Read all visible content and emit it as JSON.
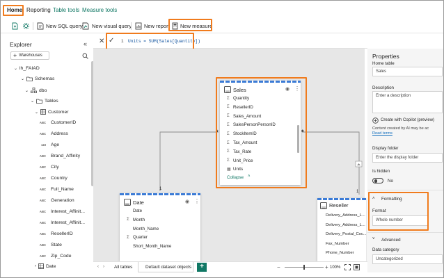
{
  "ribbon": {
    "tabs": [
      {
        "label": "Home"
      },
      {
        "label": "Reporting"
      },
      {
        "label": "Table tools"
      },
      {
        "label": "Measure tools"
      }
    ]
  },
  "toolbar": {
    "new_sql_query": "New SQL query",
    "new_visual_query": "New visual query",
    "new_report": "New report",
    "new_measure": "New measure"
  },
  "formula_bar": {
    "line_number": "1",
    "formula": "Units = SUM(Sales[Quantity])"
  },
  "explorer": {
    "title": "Explorer",
    "warehouses_button": "Warehouses",
    "tree": [
      {
        "label": "lh_FAIAD"
      },
      {
        "label": "Schemas"
      },
      {
        "label": "dbo"
      },
      {
        "label": "Tables"
      },
      {
        "label": "Customer"
      }
    ],
    "customer_columns": [
      {
        "type": "ABC",
        "name": "CustomerID"
      },
      {
        "type": "ABC",
        "name": "Address"
      },
      {
        "type": "123",
        "name": "Age"
      },
      {
        "type": "ABC",
        "name": "Brand_Affinity"
      },
      {
        "type": "ABC",
        "name": "City"
      },
      {
        "type": "ABC",
        "name": "Country"
      },
      {
        "type": "ABC",
        "name": "Full_Name"
      },
      {
        "type": "ABC",
        "name": "Generation"
      },
      {
        "type": "ABC",
        "name": "Interest_Affinit..."
      },
      {
        "type": "ABC",
        "name": "Interest_Affinit..."
      },
      {
        "type": "ABC",
        "name": "ResellerID"
      },
      {
        "type": "ABC",
        "name": "State"
      },
      {
        "type": "ABC",
        "name": "Zip_Code"
      }
    ],
    "date_table": "Date"
  },
  "sales_table": {
    "title": "Sales",
    "fields": [
      {
        "icon": "Σ",
        "name": "Quantity"
      },
      {
        "icon": "Σ",
        "name": "ResellerID"
      },
      {
        "icon": "Σ",
        "name": "Sales_Amount"
      },
      {
        "icon": "Σ",
        "name": "SalesPersonPersonID"
      },
      {
        "icon": "Σ",
        "name": "StockItemID"
      },
      {
        "icon": "Σ",
        "name": "Tax_Amount"
      },
      {
        "icon": "Σ",
        "name": "Tax_Rate"
      },
      {
        "icon": "Σ",
        "name": "Unit_Price"
      },
      {
        "icon": "▦",
        "name": "Units"
      }
    ],
    "collapse": "Collapse"
  },
  "date_card": {
    "title": "Date",
    "fields": [
      {
        "icon": "",
        "name": "Date"
      },
      {
        "icon": "Σ",
        "name": "Month"
      },
      {
        "icon": "",
        "name": "Month_Name"
      },
      {
        "icon": "Σ",
        "name": "Quarter"
      },
      {
        "icon": "",
        "name": "Short_Month_Name"
      }
    ]
  },
  "reseller_card": {
    "title": "Reseller",
    "fields": [
      {
        "name": "Delivery_Address_L..."
      },
      {
        "name": "Delivery_Address_L..."
      },
      {
        "name": "Delivery_Postal_Coc..."
      },
      {
        "name": "Fax_Number"
      },
      {
        "name": "Phone_Number"
      }
    ]
  },
  "relationships": {
    "sales_date_left": "*",
    "sales_date_right": "1",
    "sales_reseller_left": "*",
    "reseller_end": "1"
  },
  "bottom_tabs": {
    "all_tables": "All tables",
    "default_objects": "Default dataset objects",
    "add": "+",
    "zoom": "100%"
  },
  "properties": {
    "title": "Properties",
    "home_table_label": "Home table",
    "home_table_value": "Sales",
    "description_label": "Description",
    "description_placeholder": "Enter a description",
    "copilot_button": "Create with Copilot (preview)",
    "ai_note": "Content created by AI may be ac",
    "read_terms": "Read terms",
    "display_folder_label": "Display folder",
    "display_folder_placeholder": "Enter the display folder",
    "is_hidden_label": "Is hidden",
    "is_hidden_value": "No",
    "formatting_section": "Formatting",
    "format_label": "Format",
    "format_value": "Whole number",
    "advanced_section": "Advanced",
    "data_category_label": "Data category",
    "data_category_value": "Uncategorized"
  },
  "colors": {
    "highlight": "#f07b1d",
    "accent_green": "#117865",
    "table_bar_blue": "#3b7bd6"
  }
}
